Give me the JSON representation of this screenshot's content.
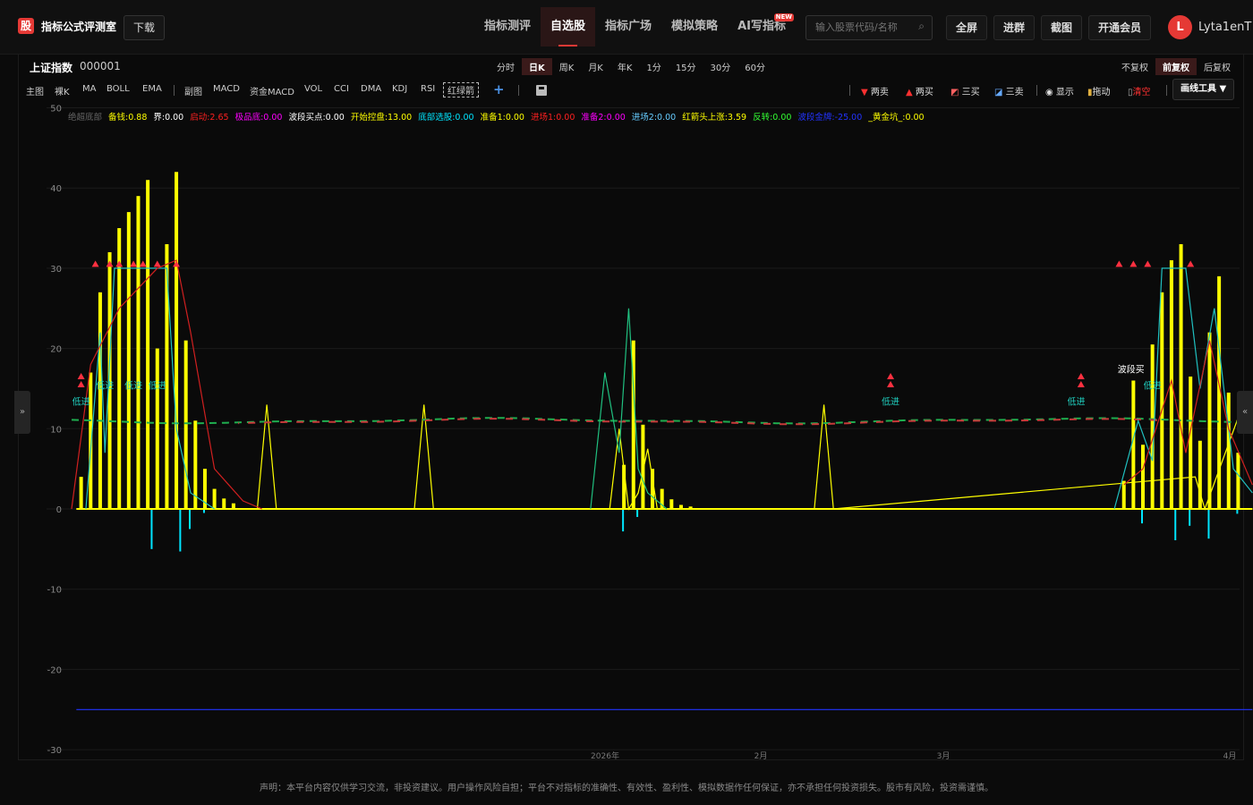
{
  "brand": {
    "logo": "股",
    "name": "指标公式评测室",
    "download": "下载"
  },
  "nav": [
    {
      "label": "指标测评",
      "active": false
    },
    {
      "label": "自选股",
      "active": true
    },
    {
      "label": "指标广场",
      "active": false
    },
    {
      "label": "模拟策略",
      "active": false
    },
    {
      "label": "AI写指标",
      "active": false,
      "badge": "NEW"
    }
  ],
  "search": {
    "placeholder": "输入股票代码/名称"
  },
  "top_buttons": {
    "fullscreen": "全屏",
    "join_group": "进群",
    "screenshot": "截图",
    "vip": "开通会员"
  },
  "user": {
    "initial": "L",
    "name": "Lyta1enT"
  },
  "stock": {
    "name": "上证指数",
    "code": "000001"
  },
  "periods": [
    {
      "label": "分时",
      "active": false
    },
    {
      "label": "日K",
      "active": true
    },
    {
      "label": "周K",
      "active": false
    },
    {
      "label": "月K",
      "active": false
    },
    {
      "label": "年K",
      "active": false
    },
    {
      "label": "1分",
      "active": false
    },
    {
      "label": "15分",
      "active": false
    },
    {
      "label": "30分",
      "active": false
    },
    {
      "label": "60分",
      "active": false
    }
  ],
  "adjust": [
    {
      "label": "不复权",
      "active": false
    },
    {
      "label": "前复权",
      "active": true
    },
    {
      "label": "后复权",
      "active": false
    }
  ],
  "indicators_main": [
    "主图",
    "裸K",
    "MA",
    "BOLL",
    "EMA"
  ],
  "indicators_sub": [
    "副图",
    "MACD",
    "资金MACD",
    "VOL",
    "CCI",
    "DMA",
    "KDJ",
    "RSI"
  ],
  "indicator_active": "红绿箭",
  "tools": {
    "two_sell": "两卖",
    "two_buy": "两买",
    "three_buy": "三买",
    "three_sell": "三卖",
    "show": "显示",
    "drag": "拖动",
    "clear": "清空",
    "drawing": "画线工具 ▼"
  },
  "legend": [
    {
      "label": "绝超底部",
      "value": "",
      "color": "#666666"
    },
    {
      "label": "备钱",
      "value": "0.88",
      "color": "#ffff00"
    },
    {
      "label": "界",
      "value": "0.00",
      "color": "#ffffff"
    },
    {
      "label": "启动",
      "value": "2.65",
      "color": "#ff2020"
    },
    {
      "label": "极品底",
      "value": "0.00",
      "color": "#ff00ff"
    },
    {
      "label": "波段买点",
      "value": "0.00",
      "color": "#ffffff"
    },
    {
      "label": "开始控盘",
      "value": "13.00",
      "color": "#ffff00"
    },
    {
      "label": "底部选股",
      "value": "0.00",
      "color": "#00e5ff"
    },
    {
      "label": "准备1",
      "value": "0.00",
      "color": "#ffff00"
    },
    {
      "label": "进场1",
      "value": "0.00",
      "color": "#ff2020"
    },
    {
      "label": "准备2",
      "value": "0.00",
      "color": "#ff00ff"
    },
    {
      "label": "进场2",
      "value": "0.00",
      "color": "#66ccff"
    },
    {
      "label": "红箭头上涨",
      "value": "3.59",
      "color": "#ffff00"
    },
    {
      "label": "反转",
      "value": "0.00",
      "color": "#33ff33"
    },
    {
      "label": "波段金牌",
      "value": "-25.00",
      "color": "#2233ff"
    },
    {
      "label": "_黄金坑_",
      "value": "0.00",
      "color": "#ffff00"
    }
  ],
  "annotations": {
    "low_entry": "低进",
    "band_buy": "波段买"
  },
  "footer": "声明：本平台内容仅供学习交流，非投资建议。用户操作风险自担；平台不对指标的准确性、有效性、盈利性、模拟数据作任何保证，亦不承担任何投资损失。股市有风险，投资需谨慎。",
  "chart_data": {
    "type": "bar",
    "ylim": [
      -30,
      50
    ],
    "yticks": [
      50,
      40,
      30,
      20,
      10,
      0,
      -10,
      -20,
      -30
    ],
    "xticks": [
      "2026年",
      "2月",
      "3月",
      "4月"
    ],
    "grid": true,
    "series": [
      {
        "name": "开始控盘",
        "color": "#ffff00",
        "kind": "bar",
        "values": [
          [
            2,
            4
          ],
          [
            4,
            17
          ],
          [
            6,
            27
          ],
          [
            8,
            32
          ],
          [
            10,
            35
          ],
          [
            12,
            37
          ],
          [
            14,
            39
          ],
          [
            16,
            41
          ],
          [
            18,
            20
          ],
          [
            20,
            33
          ],
          [
            22,
            42
          ],
          [
            24,
            21
          ],
          [
            26,
            11
          ],
          [
            28,
            5
          ],
          [
            30,
            2.5
          ],
          [
            32,
            1.3
          ],
          [
            34,
            0.7
          ],
          [
            116,
            5.5
          ],
          [
            118,
            21
          ],
          [
            120,
            10.5
          ],
          [
            122,
            5
          ],
          [
            124,
            2.5
          ],
          [
            126,
            1.2
          ],
          [
            128,
            0.5
          ],
          [
            130,
            0.3
          ],
          [
            221,
            3.5
          ],
          [
            223,
            16
          ],
          [
            225,
            8
          ],
          [
            227,
            20.5
          ],
          [
            229,
            27
          ],
          [
            231,
            31
          ],
          [
            233,
            33
          ],
          [
            235,
            16.5
          ],
          [
            237,
            8.5
          ],
          [
            239,
            22
          ],
          [
            241,
            29
          ],
          [
            243,
            14.5
          ],
          [
            245,
            7
          ]
        ]
      },
      {
        "name": "底部选股",
        "color": "#00e5ff",
        "kind": "bar",
        "values": [
          [
            17,
            -5
          ],
          [
            23,
            -5.3
          ],
          [
            25,
            -2.5
          ],
          [
            28,
            -0.5
          ],
          [
            116,
            -2.8
          ],
          [
            119,
            -1
          ],
          [
            225,
            -1.8
          ],
          [
            232,
            -3.9
          ],
          [
            235,
            -2.1
          ],
          [
            239,
            -3.7
          ],
          [
            245,
            -0.6
          ]
        ]
      },
      {
        "name": "准备1",
        "color": "#ffff00",
        "kind": "line",
        "points": [
          [
            39,
            0
          ],
          [
            41,
            13
          ],
          [
            43,
            0
          ],
          [
            72,
            0
          ],
          [
            74,
            13
          ],
          [
            76,
            0
          ],
          [
            113,
            0
          ],
          [
            115,
            10
          ],
          [
            117,
            0
          ],
          [
            119,
            2
          ],
          [
            121,
            7.5
          ],
          [
            123,
            0
          ],
          [
            130,
            0
          ],
          [
            156,
            0
          ],
          [
            158,
            13
          ],
          [
            160,
            0
          ],
          [
            236,
            4
          ],
          [
            238,
            0
          ],
          [
            246,
            13
          ]
        ]
      },
      {
        "name": "波段金牌",
        "color": "#2233ff",
        "kind": "line",
        "points": [
          [
            1,
            -25
          ],
          [
            248,
            -25
          ]
        ]
      },
      {
        "name": "_黄金坑_",
        "color": "#ffff00",
        "kind": "line",
        "points": [
          [
            1,
            0
          ],
          [
            248,
            0
          ]
        ]
      }
    ]
  }
}
